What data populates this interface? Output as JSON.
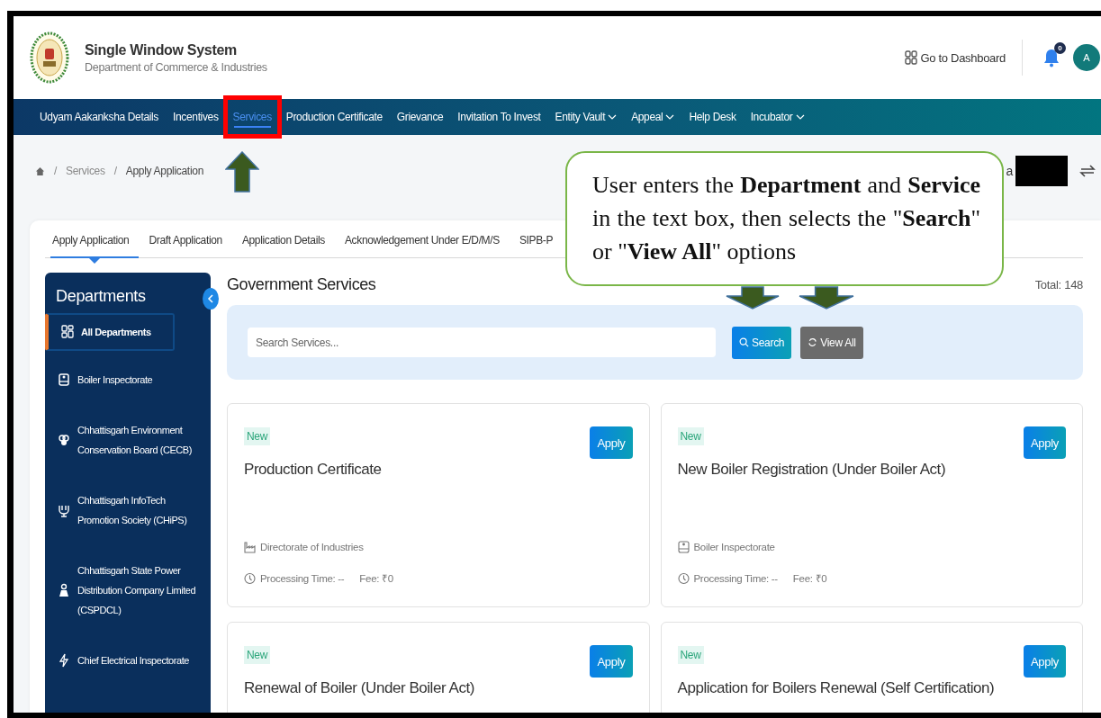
{
  "header": {
    "title": "Single Window System",
    "subtitle": "Department of Commerce & Industries",
    "dashboard_link": "Go to Dashboard",
    "notification_count": "0",
    "avatar_initial": "A"
  },
  "nav": [
    {
      "label": "Udyam Aakanksha Details",
      "selected": false,
      "has_menu": false,
      "highlighted": false
    },
    {
      "label": "Incentives",
      "selected": false,
      "has_menu": false,
      "highlighted": false
    },
    {
      "label": "Services",
      "selected": true,
      "has_menu": false,
      "highlighted": true
    },
    {
      "label": "Production Certificate",
      "selected": false,
      "has_menu": false,
      "highlighted": false
    },
    {
      "label": "Grievance",
      "selected": false,
      "has_menu": false,
      "highlighted": false
    },
    {
      "label": "Invitation To Invest",
      "selected": false,
      "has_menu": false,
      "highlighted": false
    },
    {
      "label": "Entity Vault",
      "selected": false,
      "has_menu": true,
      "highlighted": false
    },
    {
      "label": "Appeal",
      "selected": false,
      "has_menu": true,
      "highlighted": false
    },
    {
      "label": "Help Desk",
      "selected": false,
      "has_menu": false,
      "highlighted": false
    },
    {
      "label": "Incubator",
      "selected": false,
      "has_menu": true,
      "highlighted": false
    }
  ],
  "breadcrumb": [
    {
      "separator": "/",
      "label": "Services",
      "current": false
    },
    {
      "separator": "/",
      "label": "Apply Application",
      "current": true
    }
  ],
  "user_name_fragment": "a",
  "tabs": [
    {
      "label": "Apply Application",
      "selected": true
    },
    {
      "label": "Draft Application",
      "selected": false
    },
    {
      "label": "Application Details",
      "selected": false
    },
    {
      "label": "Acknowledgement Under E/D/M/S",
      "selected": false
    },
    {
      "label": "SIPB-P",
      "selected": false
    }
  ],
  "sidebar": {
    "title": "Departments",
    "items": [
      {
        "label": "All Departments",
        "selected": true
      },
      {
        "label": "Boiler Inspectorate",
        "selected": false
      },
      {
        "label": "Chhattisgarh Environment Conservation Board (CECB)",
        "selected": false
      },
      {
        "label": "Chhattisgarh InfoTech Promotion Society (CHiPS)",
        "selected": false
      },
      {
        "label": "Chhattisgarh State Power Distribution Company Limited (CSPDCL)",
        "selected": false
      },
      {
        "label": "Chief Electrical Inspectorate",
        "selected": false
      }
    ]
  },
  "services": {
    "title": "Government Services",
    "total": "Total: 148",
    "search": {
      "placeholder": "Search Services..."
    },
    "search_button": "Search",
    "view_all_button": "View All",
    "cards": [
      {
        "badge": "New",
        "title": "Production Certificate",
        "button": "Apply",
        "department": "Directorate of Industries",
        "processing_time": "Processing Time: --",
        "fee": "Fee: ₹0"
      },
      {
        "badge": "New",
        "title": "New Boiler Registration (Under Boiler Act)",
        "button": "Apply",
        "department": "Boiler Inspectorate",
        "processing_time": "Processing Time: --",
        "fee": "Fee: ₹0"
      },
      {
        "badge": "New",
        "title": "Renewal of Boiler (Under Boiler Act)",
        "button": "Apply"
      },
      {
        "badge": "New",
        "title": "Application for Boilers Renewal (Self Certification)",
        "button": "Apply"
      }
    ]
  },
  "annotations": {
    "callout": "User enters the **Department** and **Service** in the text box, then selects the \"**Search**\" or \"**View All**\" options",
    "arrows": [
      {
        "kind": "up"
      },
      {
        "kind": "down"
      },
      {
        "kind": "down"
      }
    ]
  }
}
